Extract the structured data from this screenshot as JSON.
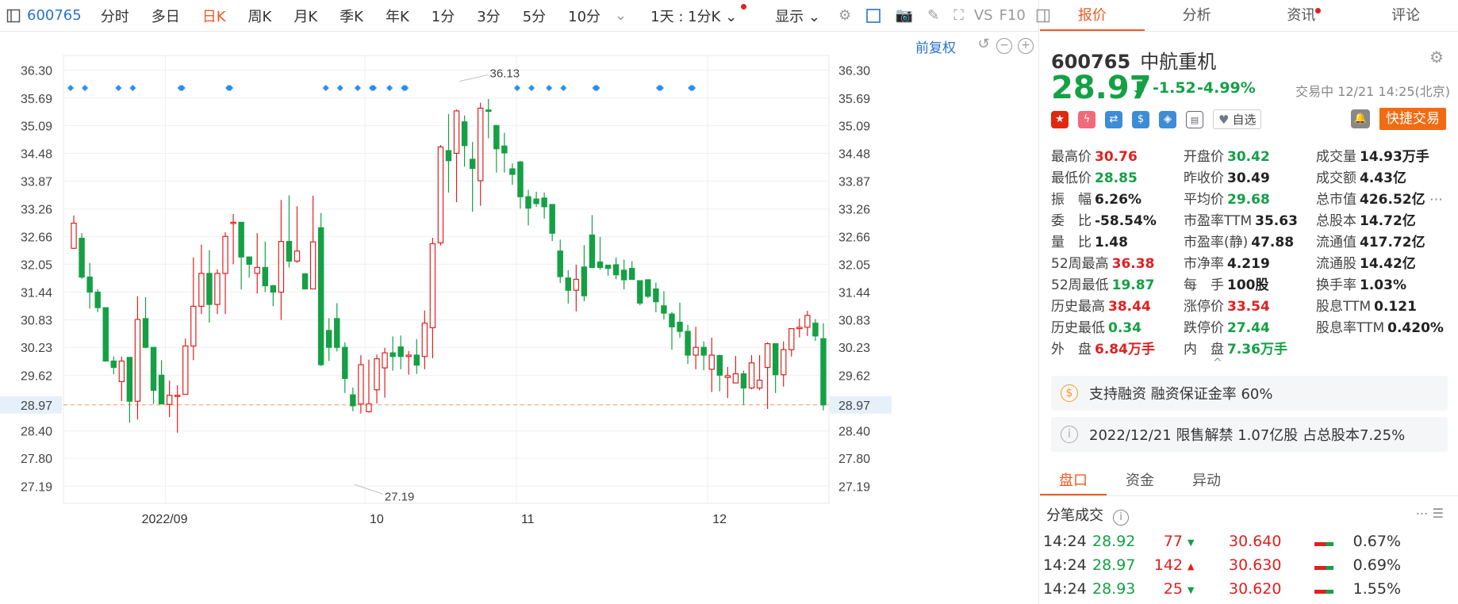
{
  "toolbar": {
    "code": "600765",
    "tabs": [
      "分时",
      "多日",
      "日K",
      "周K",
      "月K",
      "季K",
      "年K",
      "1分",
      "3分",
      "5分",
      "10分"
    ],
    "active": "日K",
    "period": "1天 : 1分K",
    "display": "显示",
    "vs": "VS",
    "f10": "F10"
  },
  "chart": {
    "fqq": "前复权",
    "price_levels": [
      "36.30",
      "35.69",
      "35.09",
      "34.48",
      "33.87",
      "33.26",
      "32.66",
      "32.05",
      "31.44",
      "30.83",
      "30.23",
      "29.62",
      "28.97",
      "28.40",
      "27.80",
      "27.19"
    ],
    "current_price": "28.97",
    "high_label": "36.13",
    "low_label": "27.19",
    "months": [
      "2022/09",
      "10",
      "11",
      "12"
    ]
  },
  "chart_data": {
    "type": "candlestick",
    "ylim": [
      26.9,
      36.45
    ],
    "y_ticks": [
      36.3,
      35.69,
      35.09,
      34.48,
      33.87,
      33.26,
      32.66,
      32.05,
      31.44,
      30.83,
      30.23,
      29.62,
      28.97,
      28.4,
      27.8,
      27.19
    ],
    "x_ticks": [
      "2022/09",
      "10",
      "11",
      "12"
    ],
    "max": 36.13,
    "min": 27.19,
    "last": 28.97,
    "candles": [
      [
        32.4,
        32.95,
        32.38,
        33.12
      ],
      [
        32.62,
        31.77,
        31.73,
        32.73
      ],
      [
        31.77,
        31.44,
        31.08,
        32.08
      ],
      [
        31.44,
        31.1,
        31.0,
        31.5
      ],
      [
        31.1,
        29.93,
        29.93,
        31.1
      ],
      [
        29.93,
        29.79,
        29.64,
        30.03
      ],
      [
        29.48,
        29.93,
        29.05,
        30.03
      ],
      [
        30.01,
        29.05,
        28.58,
        30.01
      ],
      [
        29.05,
        30.84,
        28.65,
        31.35
      ],
      [
        30.86,
        30.23,
        30.21,
        31.33
      ],
      [
        30.23,
        29.29,
        28.99,
        30.23
      ],
      [
        29.62,
        28.99,
        28.99,
        29.95
      ],
      [
        28.98,
        29.18,
        28.7,
        29.5
      ],
      [
        29.18,
        29.18,
        28.36,
        29.4
      ],
      [
        29.2,
        30.26,
        29.35,
        30.42
      ],
      [
        30.26,
        31.13,
        29.95,
        32.2
      ],
      [
        31.13,
        31.85,
        30.96,
        32.48
      ],
      [
        31.85,
        31.17,
        30.77,
        32.36
      ],
      [
        31.17,
        31.85,
        30.96,
        31.94
      ],
      [
        31.85,
        32.66,
        30.96,
        32.75
      ],
      [
        32.97,
        32.97,
        32.05,
        33.15
      ],
      [
        32.97,
        32.21,
        31.5,
        32.97
      ],
      [
        32.21,
        32.05,
        31.76,
        32.22
      ],
      [
        31.85,
        31.98,
        31.41,
        32.73
      ],
      [
        31.98,
        31.58,
        31.44,
        32.55
      ],
      [
        31.58,
        31.44,
        31.13,
        31.6
      ],
      [
        31.44,
        32.55,
        30.83,
        33.46
      ],
      [
        32.55,
        32.12,
        31.98,
        33.56
      ],
      [
        32.12,
        32.34,
        32.08,
        33.32
      ],
      [
        31.84,
        31.51,
        31.51,
        31.86
      ],
      [
        31.51,
        32.54,
        31.51,
        33.55
      ],
      [
        32.85,
        29.85,
        29.82,
        33.17
      ],
      [
        30.6,
        30.23,
        29.93,
        30.87
      ],
      [
        30.86,
        30.23,
        30.14,
        31.2
      ],
      [
        30.23,
        29.55,
        29.23,
        30.34
      ],
      [
        29.19,
        28.95,
        28.83,
        29.35
      ],
      [
        28.99,
        29.85,
        28.78,
        30.06
      ],
      [
        28.82,
        28.99,
        28.8,
        29.96
      ],
      [
        29.3,
        29.98,
        29.0,
        30.07
      ],
      [
        29.78,
        30.11,
        29.13,
        30.22
      ],
      [
        30.11,
        30.03,
        29.72,
        30.47
      ],
      [
        30.24,
        30.03,
        29.75,
        30.49
      ],
      [
        30.03,
        30.06,
        29.63,
        30.15
      ],
      [
        30.06,
        29.84,
        29.65,
        30.41
      ],
      [
        30.03,
        30.76,
        29.75,
        31.04
      ],
      [
        30.66,
        32.5,
        29.99,
        32.63
      ],
      [
        32.52,
        34.62,
        32.46,
        34.66
      ],
      [
        34.54,
        34.32,
        33.62,
        35.34
      ],
      [
        34.48,
        35.41,
        33.41,
        35.44
      ],
      [
        35.17,
        34.65,
        34.19,
        35.31
      ],
      [
        34.35,
        34.15,
        33.2,
        34.73
      ],
      [
        33.88,
        35.47,
        33.33,
        35.59
      ],
      [
        35.43,
        35.4,
        34.81,
        35.67
      ],
      [
        35.09,
        34.58,
        34.06,
        35.09
      ],
      [
        34.64,
        34.49,
        34.06,
        34.93
      ],
      [
        34.14,
        34.02,
        33.79,
        34.26
      ],
      [
        34.29,
        33.53,
        33.27,
        34.31
      ],
      [
        33.53,
        33.28,
        32.9,
        33.68
      ],
      [
        33.48,
        33.38,
        33.31,
        33.64
      ],
      [
        33.5,
        33.31,
        33.05,
        33.62
      ],
      [
        33.36,
        32.73,
        32.56,
        33.36
      ],
      [
        32.34,
        31.78,
        31.64,
        32.59
      ],
      [
        31.75,
        31.48,
        31.19,
        31.92
      ],
      [
        31.48,
        31.72,
        31.02,
        32.04
      ],
      [
        31.99,
        31.36,
        31.24,
        32.47
      ],
      [
        32.69,
        31.98,
        32.15,
        33.13
      ],
      [
        32.1,
        31.98,
        31.93,
        32.65
      ],
      [
        32.03,
        31.96,
        31.8,
        32.03
      ],
      [
        32.04,
        31.82,
        31.72,
        32.2
      ],
      [
        31.92,
        31.71,
        31.5,
        32.15
      ],
      [
        31.96,
        31.72,
        31.77,
        32.12
      ],
      [
        31.69,
        31.2,
        31.15,
        31.7
      ],
      [
        31.71,
        31.35,
        31.31,
        31.68
      ],
      [
        31.51,
        31.23,
        31.0,
        31.65
      ],
      [
        31.14,
        30.98,
        30.84,
        31.46
      ],
      [
        30.96,
        30.68,
        30.18,
        31.0
      ],
      [
        30.78,
        30.58,
        30.44,
        31.21
      ],
      [
        30.58,
        30.06,
        29.87,
        30.72
      ],
      [
        30.06,
        30.23,
        29.75,
        30.68
      ],
      [
        30.23,
        30.06,
        29.73,
        30.36
      ],
      [
        29.75,
        30.06,
        29.25,
        30.44
      ],
      [
        30.05,
        29.62,
        29.27,
        30.07
      ],
      [
        29.57,
        29.61,
        29.12,
        29.8
      ],
      [
        29.45,
        29.65,
        29.45,
        30.04
      ],
      [
        29.65,
        29.34,
        28.97,
        29.72
      ],
      [
        29.34,
        29.89,
        29.31,
        30.06
      ],
      [
        29.34,
        29.51,
        29.29,
        30.06
      ],
      [
        29.79,
        30.31,
        28.88,
        30.34
      ],
      [
        30.31,
        29.63,
        29.23,
        30.25
      ],
      [
        29.63,
        30.18,
        29.37,
        30.36
      ],
      [
        30.18,
        30.64,
        30.03,
        30.54
      ],
      [
        30.64,
        30.67,
        30.45,
        30.86
      ],
      [
        30.67,
        30.93,
        30.48,
        31.03
      ],
      [
        30.76,
        30.48,
        30.37,
        30.85
      ],
      [
        30.42,
        28.97,
        28.85,
        30.76
      ]
    ]
  },
  "right": {
    "tabs": [
      "报价",
      "分析",
      "资讯",
      "评论"
    ],
    "active_tab": "报价",
    "code": "600765",
    "name": "中航重机",
    "price": "28.97",
    "change": "-1.52",
    "change_pct": "-4.99%",
    "status": "交易中 12/21 14:25(北京)",
    "zixuan": "自选",
    "quick_trade": "快捷交易",
    "stats": [
      [
        {
          "k": "最高价",
          "v": "30.76",
          "c": "red"
        },
        {
          "k": "开盘价",
          "v": "30.42",
          "c": "green"
        },
        {
          "k": "成交量",
          "v": "14.93万手",
          "c": "blk"
        }
      ],
      [
        {
          "k": "最低价",
          "v": "28.85",
          "c": "green"
        },
        {
          "k": "昨收价",
          "v": "30.49",
          "c": "blk"
        },
        {
          "k": "成交额",
          "v": "4.43亿",
          "c": "blk"
        }
      ],
      [
        {
          "k": "振　幅",
          "v": "6.26%",
          "c": "blk"
        },
        {
          "k": "平均价",
          "v": "29.68",
          "c": "green"
        },
        {
          "k": "总市值",
          "v": "426.52亿",
          "c": "blk"
        }
      ],
      [
        {
          "k": "委　比",
          "v": "-58.54%",
          "c": "blk"
        },
        {
          "k": "市盈率TTM",
          "v": "35.63",
          "c": "blk"
        },
        {
          "k": "总股本",
          "v": "14.72亿",
          "c": "blk"
        }
      ],
      [
        {
          "k": "量　比",
          "v": "1.48",
          "c": "blk"
        },
        {
          "k": "市盈率(静)",
          "v": "47.88",
          "c": "blk"
        },
        {
          "k": "流通值",
          "v": "417.72亿",
          "c": "blk"
        }
      ],
      [
        {
          "k": "52周最高",
          "v": "36.38",
          "c": "red"
        },
        {
          "k": "市净率",
          "v": "4.219",
          "c": "blk"
        },
        {
          "k": "流通股",
          "v": "14.42亿",
          "c": "blk"
        }
      ],
      [
        {
          "k": "52周最低",
          "v": "19.87",
          "c": "green"
        },
        {
          "k": "每　手",
          "v": "100股",
          "c": "blk"
        },
        {
          "k": "换手率",
          "v": "1.03%",
          "c": "blk"
        }
      ],
      [
        {
          "k": "历史最高",
          "v": "38.44",
          "c": "red"
        },
        {
          "k": "涨停价",
          "v": "33.54",
          "c": "red"
        },
        {
          "k": "股息TTM",
          "v": "0.121",
          "c": "blk"
        }
      ],
      [
        {
          "k": "历史最低",
          "v": "0.34",
          "c": "green"
        },
        {
          "k": "跌停价",
          "v": "27.44",
          "c": "green"
        },
        {
          "k": "股息率TTM",
          "v": "0.420%",
          "c": "blk"
        }
      ],
      [
        {
          "k": "外　盘",
          "v": "6.84万手",
          "c": "red"
        },
        {
          "k": "内　盘",
          "v": "7.36万手",
          "c": "green"
        },
        {
          "k": "",
          "v": "",
          "c": "blk"
        }
      ]
    ],
    "margin": "支持融资 融资保证金率 60%",
    "unlock": "2022/12/21  限售解禁 1.07亿股 占总股本7.25%",
    "bottom_tabs": [
      "盘口",
      "资金",
      "异动"
    ],
    "trades_title": "分笔成交",
    "trades": [
      {
        "t": "14:24",
        "p": "28.92",
        "v": "77",
        "dir": "down",
        "bp": "30.640",
        "pct": "0.67%"
      },
      {
        "t": "14:24",
        "p": "28.97",
        "v": "142",
        "dir": "up",
        "bp": "30.630",
        "pct": "0.69%"
      },
      {
        "t": "14:24",
        "p": "28.93",
        "v": "25",
        "dir": "down",
        "bp": "30.620",
        "pct": "1.55%"
      }
    ]
  }
}
